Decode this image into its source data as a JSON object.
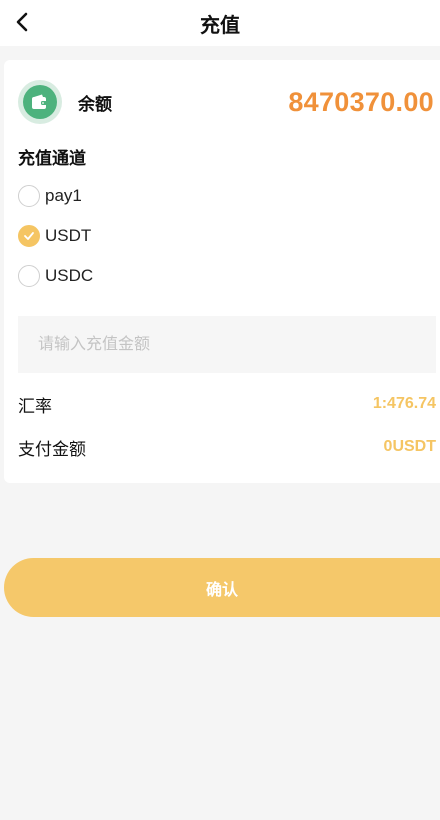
{
  "header": {
    "title": "充值",
    "back_icon": "chevron-left-icon"
  },
  "balance": {
    "icon": "wallet-icon",
    "label": "余额",
    "value": "8470370.00"
  },
  "channels": {
    "title": "充值通道",
    "options": [
      {
        "label": "pay1",
        "checked": false
      },
      {
        "label": "USDT",
        "checked": true
      },
      {
        "label": "USDC",
        "checked": false
      }
    ]
  },
  "amount": {
    "placeholder": "请输入充值金额",
    "value": ""
  },
  "exchange_rate": {
    "label": "汇率",
    "value": "1:476.74"
  },
  "pay_amount": {
    "label": "支付金额",
    "value": "0USDT"
  },
  "confirm": {
    "label": "确认"
  },
  "colors": {
    "accent": "#f5c563",
    "balance": "#f0913a",
    "wallet": "#4db27d"
  }
}
